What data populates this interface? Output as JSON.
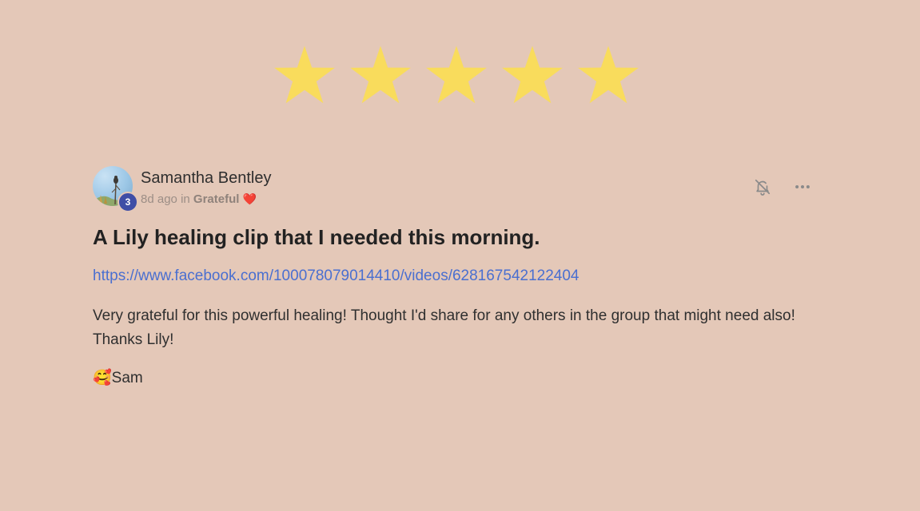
{
  "rating": {
    "stars_filled": 5,
    "stars_total": 5,
    "star_color": "#f9dc5c"
  },
  "post": {
    "author": "Samantha Bentley",
    "avatar_badge": "3",
    "time_ago": "8d ago",
    "in_text": "in",
    "category": "Grateful",
    "category_emoji": "❤️",
    "title": "A Lily healing clip that I needed this morning.",
    "link": "https://www.facebook.com/100078079014410/videos/628167542122404",
    "body_lines": [
      "Very grateful for this powerful healing! Thought I'd share for any others in the group that might need also!",
      "Thanks Lily!"
    ],
    "signoff_emoji": "🥰",
    "signoff_name": "Sam"
  },
  "actions": {
    "notify_icon": "bell-off-icon",
    "more_icon": "more-horizontal-icon"
  },
  "colors": {
    "background": "#e4c8b8",
    "link": "#4a6fd0",
    "badge": "#3f4ea6"
  }
}
